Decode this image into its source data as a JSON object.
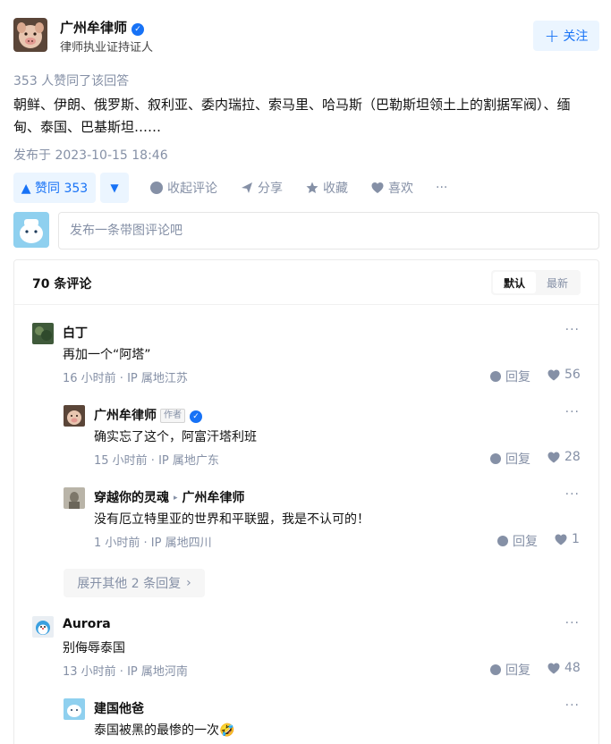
{
  "answer_author": {
    "name": "广州牟律师",
    "description": "律师执业证持证人",
    "follow_label": "关注",
    "follow_icon": "plus-icon",
    "verified_icon": "verified-icon"
  },
  "answer": {
    "votes_line": "353 人赞同了该回答",
    "content": "朝鲜、伊朗、俄罗斯、叙利亚、委内瑞拉、索马里、哈马斯（巴勒斯坦领土上的割据军阀）、缅甸、泰国、巴基斯坦……",
    "publish_time": "发布于 2023-10-15 18:46"
  },
  "actions": {
    "vote_up_label": "▲ 赞同 353",
    "vote_down_label": "▼",
    "comment_label": "收起评论",
    "share_label": "分享",
    "favorite_label": "收藏",
    "like_label": "喜欢",
    "more_label": "···"
  },
  "comment_input": {
    "placeholder": "发布一条带图评论吧"
  },
  "comments": {
    "count_label": "70 条评论",
    "sort_default": "默认",
    "sort_latest": "最新",
    "reply_label": "回复",
    "more_label": "···",
    "items": [
      {
        "name": "白丁",
        "text": "再加一个“阿塔”",
        "meta": "16 小时前 · IP 属地江苏",
        "likes": "56"
      },
      {
        "name": "广州牟律师",
        "tag": "作者",
        "text": "确实忘了这个，阿富汗塔利班",
        "meta": "15 小时前 · IP 属地广东",
        "likes": "28"
      },
      {
        "name": "穿越你的灵魂",
        "reply_to": "广州牟律师",
        "text": "没有厄立特里亚的世界和平联盟，我是不认可的！",
        "meta": "1 小时前 · IP 属地四川",
        "likes": "1"
      },
      {
        "name": "Aurora",
        "text": "别侮辱泰国",
        "meta": "13 小时前 · IP 属地河南",
        "likes": "48"
      },
      {
        "name": "建国他爸",
        "text": "泰国被黑的最惨的一次🤣",
        "meta": "",
        "likes": ""
      }
    ],
    "expand_label": "展开其他 2 条回复"
  },
  "colors": {
    "brand_blue": "#1772f6",
    "light_blue_bg": "#ebf5ff",
    "gray_text": "#8590a6"
  }
}
